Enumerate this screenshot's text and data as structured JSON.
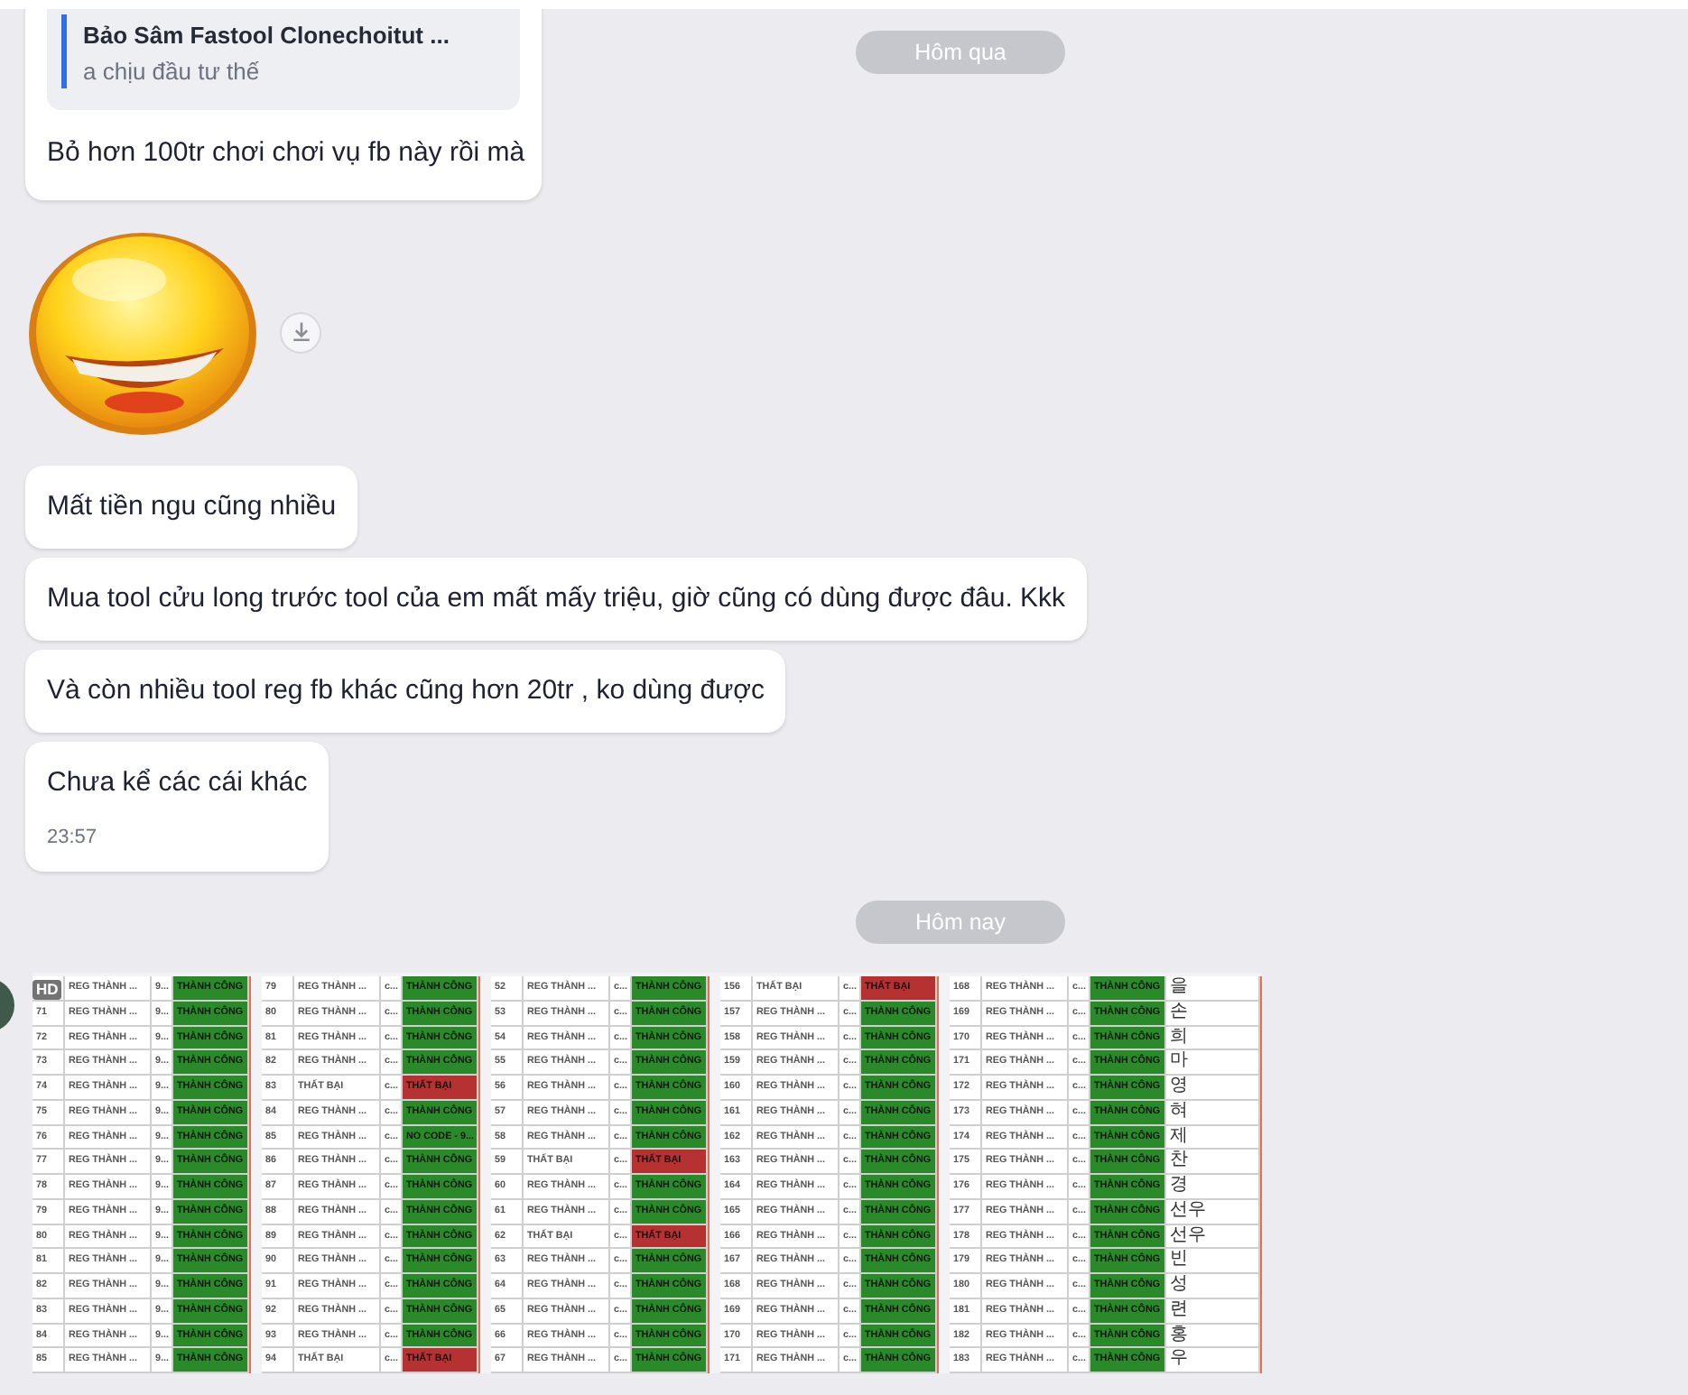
{
  "quoted_message": {
    "quote": {
      "author": "Bảo Sâm Fastool Clonechoitut ...",
      "text": "a chịu đầu tư thế"
    },
    "text": "Bỏ hơn 100tr chơi chơi vụ fb này rồi mà"
  },
  "date_separators": [
    "Hôm qua",
    "Hôm nay"
  ],
  "messages": [
    {
      "text": "Mất tiền ngu cũng nhiều"
    },
    {
      "text": "Mua tool cửu long trước tool của em mất mấy triệu, giờ cũng có dùng được đâu. Kkk"
    },
    {
      "text": "Và còn nhiều tool reg fb khác cũng hơn 20tr , ko dùng được"
    },
    {
      "text": "Chưa kể các cái khác",
      "time": "23:57"
    }
  ],
  "image_album": {
    "badge": "HD",
    "panels": [
      {
        "rows": [
          {
            "name": "REG THÀNH ...",
            "code": "9...",
            "status": "THÀNH CÔNG",
            "kind": "success"
          },
          {
            "no": "71",
            "name": "REG THÀNH ...",
            "code": "9...",
            "status": "THÀNH CÔNG",
            "kind": "success"
          },
          {
            "no": "72",
            "name": "REG THÀNH ...",
            "code": "9...",
            "status": "THÀNH CÔNG",
            "kind": "success"
          },
          {
            "no": "73",
            "name": "REG THÀNH ...",
            "code": "9...",
            "status": "THÀNH CÔNG",
            "kind": "success"
          },
          {
            "no": "74",
            "name": "REG THÀNH ...",
            "code": "9...",
            "status": "THÀNH CÔNG",
            "kind": "success"
          },
          {
            "no": "75",
            "name": "REG THÀNH ...",
            "code": "9...",
            "status": "THÀNH CÔNG",
            "kind": "success"
          },
          {
            "no": "76",
            "name": "REG THÀNH ...",
            "code": "9...",
            "status": "THÀNH CÔNG",
            "kind": "success"
          },
          {
            "no": "77",
            "name": "REG THÀNH ...",
            "code": "9...",
            "status": "THÀNH CÔNG",
            "kind": "success"
          },
          {
            "no": "78",
            "name": "REG THÀNH ...",
            "code": "9...",
            "status": "THÀNH CÔNG",
            "kind": "success"
          },
          {
            "no": "79",
            "name": "REG THÀNH ...",
            "code": "9...",
            "status": "THÀNH CÔNG",
            "kind": "success"
          },
          {
            "no": "80",
            "name": "REG THÀNH ...",
            "code": "9...",
            "status": "THÀNH CÔNG",
            "kind": "success"
          },
          {
            "no": "81",
            "name": "REG THÀNH ...",
            "code": "9...",
            "status": "THÀNH CÔNG",
            "kind": "success"
          },
          {
            "no": "82",
            "name": "REG THÀNH ...",
            "code": "9...",
            "status": "THÀNH CÔNG",
            "kind": "success"
          },
          {
            "no": "83",
            "name": "REG THÀNH ...",
            "code": "9...",
            "status": "THÀNH CÔNG",
            "kind": "success"
          },
          {
            "no": "84",
            "name": "REG THÀNH ...",
            "code": "9...",
            "status": "THÀNH CÔNG",
            "kind": "success"
          },
          {
            "no": "85",
            "name": "REG THÀNH ...",
            "code": "9...",
            "status": "THÀNH CÔNG",
            "kind": "success"
          }
        ]
      },
      {
        "rows": [
          {
            "no": "79",
            "name": "REG THÀNH ...",
            "code": "c...",
            "status": "THÀNH CÔNG",
            "kind": "success"
          },
          {
            "no": "80",
            "name": "REG THÀNH ...",
            "code": "c...",
            "status": "THÀNH CÔNG",
            "kind": "success"
          },
          {
            "no": "81",
            "name": "REG THÀNH ...",
            "code": "c...",
            "status": "THÀNH CÔNG",
            "kind": "success"
          },
          {
            "no": "82",
            "name": "REG THÀNH ...",
            "code": "c...",
            "status": "THÀNH CÔNG",
            "kind": "success"
          },
          {
            "no": "83",
            "name": "THẤT BẠI",
            "code": "c...",
            "status": "THẤT BẠI",
            "kind": "fail"
          },
          {
            "no": "84",
            "name": "REG THÀNH ...",
            "code": "c...",
            "status": "THÀNH CÔNG",
            "kind": "success"
          },
          {
            "no": "85",
            "name": "REG THÀNH ...",
            "code": "c...",
            "status": "NO CODE - 9...",
            "kind": "success"
          },
          {
            "no": "86",
            "name": "REG THÀNH ...",
            "code": "c...",
            "status": "THÀNH CÔNG",
            "kind": "success"
          },
          {
            "no": "87",
            "name": "REG THÀNH ...",
            "code": "c...",
            "status": "THÀNH CÔNG",
            "kind": "success"
          },
          {
            "no": "88",
            "name": "REG THÀNH ...",
            "code": "c...",
            "status": "THÀNH CÔNG",
            "kind": "success"
          },
          {
            "no": "89",
            "name": "REG THÀNH ...",
            "code": "c...",
            "status": "THÀNH CÔNG",
            "kind": "success"
          },
          {
            "no": "90",
            "name": "REG THÀNH ...",
            "code": "c...",
            "status": "THÀNH CÔNG",
            "kind": "success"
          },
          {
            "no": "91",
            "name": "REG THÀNH ...",
            "code": "c...",
            "status": "THÀNH CÔNG",
            "kind": "success"
          },
          {
            "no": "92",
            "name": "REG THÀNH ...",
            "code": "c...",
            "status": "THÀNH CÔNG",
            "kind": "success"
          },
          {
            "no": "93",
            "name": "REG THÀNH ...",
            "code": "c...",
            "status": "THÀNH CÔNG",
            "kind": "success"
          },
          {
            "no": "94",
            "name": "THẤT BẠI",
            "code": "c...",
            "status": "THẤT BẠI",
            "kind": "fail"
          }
        ]
      },
      {
        "rows": [
          {
            "no": "52",
            "name": "REG THÀNH ...",
            "code": "c...",
            "status": "THÀNH CÔNG",
            "kind": "success"
          },
          {
            "no": "53",
            "name": "REG THÀNH ...",
            "code": "c...",
            "status": "THÀNH CÔNG",
            "kind": "success"
          },
          {
            "no": "54",
            "name": "REG THÀNH ...",
            "code": "c...",
            "status": "THÀNH CÔNG",
            "kind": "success"
          },
          {
            "no": "55",
            "name": "REG THÀNH ...",
            "code": "c...",
            "status": "THÀNH CÔNG",
            "kind": "success"
          },
          {
            "no": "56",
            "name": "REG THÀNH ...",
            "code": "c...",
            "status": "THÀNH CÔNG",
            "kind": "success"
          },
          {
            "no": "57",
            "name": "REG THÀNH ...",
            "code": "c...",
            "status": "THÀNH CÔNG",
            "kind": "success"
          },
          {
            "no": "58",
            "name": "REG THÀNH ...",
            "code": "c...",
            "status": "THÀNH CÔNG",
            "kind": "success"
          },
          {
            "no": "59",
            "name": "THẤT BẠI",
            "code": "c...",
            "status": "THẤT BẠI",
            "kind": "fail"
          },
          {
            "no": "60",
            "name": "REG THÀNH ...",
            "code": "c...",
            "status": "THÀNH CÔNG",
            "kind": "success"
          },
          {
            "no": "61",
            "name": "REG THÀNH ...",
            "code": "c...",
            "status": "THÀNH CÔNG",
            "kind": "success"
          },
          {
            "no": "62",
            "name": "THẤT BẠI",
            "code": "c...",
            "status": "THẤT BẠI",
            "kind": "fail"
          },
          {
            "no": "63",
            "name": "REG THÀNH ...",
            "code": "c...",
            "status": "THÀNH CÔNG",
            "kind": "success"
          },
          {
            "no": "64",
            "name": "REG THÀNH ...",
            "code": "c...",
            "status": "THÀNH CÔNG",
            "kind": "success"
          },
          {
            "no": "65",
            "name": "REG THÀNH ...",
            "code": "c...",
            "status": "THÀNH CÔNG",
            "kind": "success"
          },
          {
            "no": "66",
            "name": "REG THÀNH ...",
            "code": "c...",
            "status": "THÀNH CÔNG",
            "kind": "success"
          },
          {
            "no": "67",
            "name": "REG THÀNH ...",
            "code": "c...",
            "status": "THÀNH CÔNG",
            "kind": "success"
          }
        ]
      },
      {
        "rows": [
          {
            "no": "156",
            "name": "THẤT BẠI",
            "code": "c...",
            "status": "THẤT BẠI",
            "kind": "fail"
          },
          {
            "no": "157",
            "name": "REG THÀNH ...",
            "code": "c...",
            "status": "THÀNH CÔNG",
            "kind": "success"
          },
          {
            "no": "158",
            "name": "REG THÀNH ...",
            "code": "c...",
            "status": "THÀNH CÔNG",
            "kind": "success"
          },
          {
            "no": "159",
            "name": "REG THÀNH ...",
            "code": "c...",
            "status": "THÀNH CÔNG",
            "kind": "success"
          },
          {
            "no": "160",
            "name": "REG THÀNH ...",
            "code": "c...",
            "status": "THÀNH CÔNG",
            "kind": "success"
          },
          {
            "no": "161",
            "name": "REG THÀNH ...",
            "code": "c...",
            "status": "THÀNH CÔNG",
            "kind": "success"
          },
          {
            "no": "162",
            "name": "REG THÀNH ...",
            "code": "c...",
            "status": "THÀNH CÔNG",
            "kind": "success"
          },
          {
            "no": "163",
            "name": "REG THÀNH ...",
            "code": "c...",
            "status": "THÀNH CÔNG",
            "kind": "success"
          },
          {
            "no": "164",
            "name": "REG THÀNH ...",
            "code": "c...",
            "status": "THÀNH CÔNG",
            "kind": "success"
          },
          {
            "no": "165",
            "name": "REG THÀNH ...",
            "code": "c...",
            "status": "THÀNH CÔNG",
            "kind": "success"
          },
          {
            "no": "166",
            "name": "REG THÀNH ...",
            "code": "c...",
            "status": "THÀNH CÔNG",
            "kind": "success"
          },
          {
            "no": "167",
            "name": "REG THÀNH ...",
            "code": "c...",
            "status": "THÀNH CÔNG",
            "kind": "success"
          },
          {
            "no": "168",
            "name": "REG THÀNH ...",
            "code": "c...",
            "status": "THÀNH CÔNG",
            "kind": "success"
          },
          {
            "no": "169",
            "name": "REG THÀNH ...",
            "code": "c...",
            "status": "THÀNH CÔNG",
            "kind": "success"
          },
          {
            "no": "170",
            "name": "REG THÀNH ...",
            "code": "c...",
            "status": "THÀNH CÔNG",
            "kind": "success"
          },
          {
            "no": "171",
            "name": "REG THÀNH ...",
            "code": "c...",
            "status": "THÀNH CÔNG",
            "kind": "success"
          }
        ]
      },
      {
        "rows": [
          {
            "no": "168",
            "name": "REG THÀNH ...",
            "code": "c...",
            "status": "THÀNH CÔNG",
            "kind": "success",
            "note": "을"
          },
          {
            "no": "169",
            "name": "REG THÀNH ...",
            "code": "c...",
            "status": "THÀNH CÔNG",
            "kind": "success",
            "note": "손"
          },
          {
            "no": "170",
            "name": "REG THÀNH ...",
            "code": "c...",
            "status": "THÀNH CÔNG",
            "kind": "success",
            "note": "희"
          },
          {
            "no": "171",
            "name": "REG THÀNH ...",
            "code": "c...",
            "status": "THÀNH CÔNG",
            "kind": "success",
            "note": "마"
          },
          {
            "no": "172",
            "name": "REG THÀNH ...",
            "code": "c...",
            "status": "THÀNH CÔNG",
            "kind": "success",
            "note": "영"
          },
          {
            "no": "173",
            "name": "REG THÀNH ...",
            "code": "c...",
            "status": "THÀNH CÔNG",
            "kind": "success",
            "note": "혀"
          },
          {
            "no": "174",
            "name": "REG THÀNH ...",
            "code": "c...",
            "status": "THÀNH CÔNG",
            "kind": "success",
            "note": "제"
          },
          {
            "no": "175",
            "name": "REG THÀNH ...",
            "code": "c...",
            "status": "THÀNH CÔNG",
            "kind": "success",
            "note": "찬"
          },
          {
            "no": "176",
            "name": "REG THÀNH ...",
            "code": "c...",
            "status": "THÀNH CÔNG",
            "kind": "success",
            "note": "경"
          },
          {
            "no": "177",
            "name": "REG THÀNH ...",
            "code": "c...",
            "status": "THÀNH CÔNG",
            "kind": "success",
            "note": "선우"
          },
          {
            "no": "178",
            "name": "REG THÀNH ...",
            "code": "c...",
            "status": "THÀNH CÔNG",
            "kind": "success",
            "note": "선우"
          },
          {
            "no": "179",
            "name": "REG THÀNH ...",
            "code": "c...",
            "status": "THÀNH CÔNG",
            "kind": "success",
            "note": "빈"
          },
          {
            "no": "180",
            "name": "REG THÀNH ...",
            "code": "c...",
            "status": "THÀNH CÔNG",
            "kind": "success",
            "note": "성"
          },
          {
            "no": "181",
            "name": "REG THÀNH ...",
            "code": "c...",
            "status": "THÀNH CÔNG",
            "kind": "success",
            "note": "련"
          },
          {
            "no": "182",
            "name": "REG THÀNH ...",
            "code": "c...",
            "status": "THÀNH CÔNG",
            "kind": "success",
            "note": "홍"
          },
          {
            "no": "183",
            "name": "REG THÀNH ...",
            "code": "c...",
            "status": "THÀNH CÔNG",
            "kind": "success",
            "note": "우"
          }
        ]
      }
    ]
  }
}
